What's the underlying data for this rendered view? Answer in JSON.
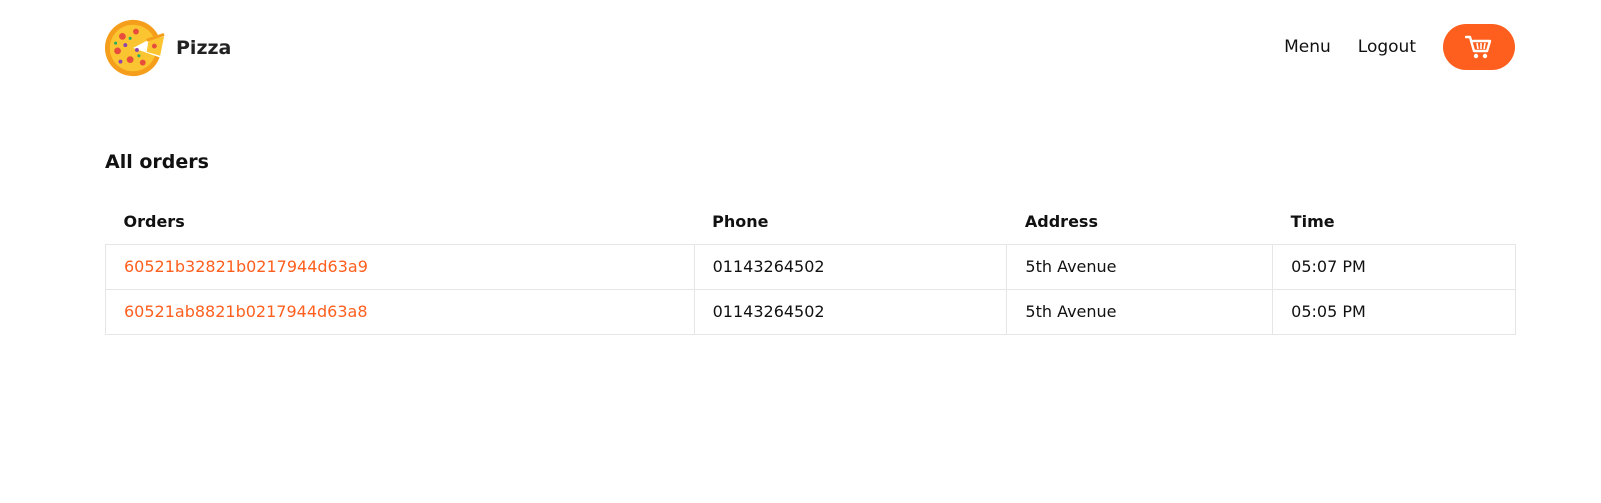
{
  "nav": {
    "brand": "Pizza",
    "links": [
      "Menu",
      "Logout"
    ],
    "cart_icon": "cart-icon",
    "accent": "#fe5f1e"
  },
  "main": {
    "title": "All orders",
    "table": {
      "headers": [
        "Orders",
        "Phone",
        "Address",
        "Time"
      ],
      "rows": [
        [
          "60521b32821b0217944d63a9",
          "01143264502",
          "5th Avenue",
          "05:07 PM"
        ],
        [
          "60521ab8821b0217944d63a8",
          "01143264502",
          "5th Avenue",
          "05:05 PM"
        ]
      ]
    }
  }
}
